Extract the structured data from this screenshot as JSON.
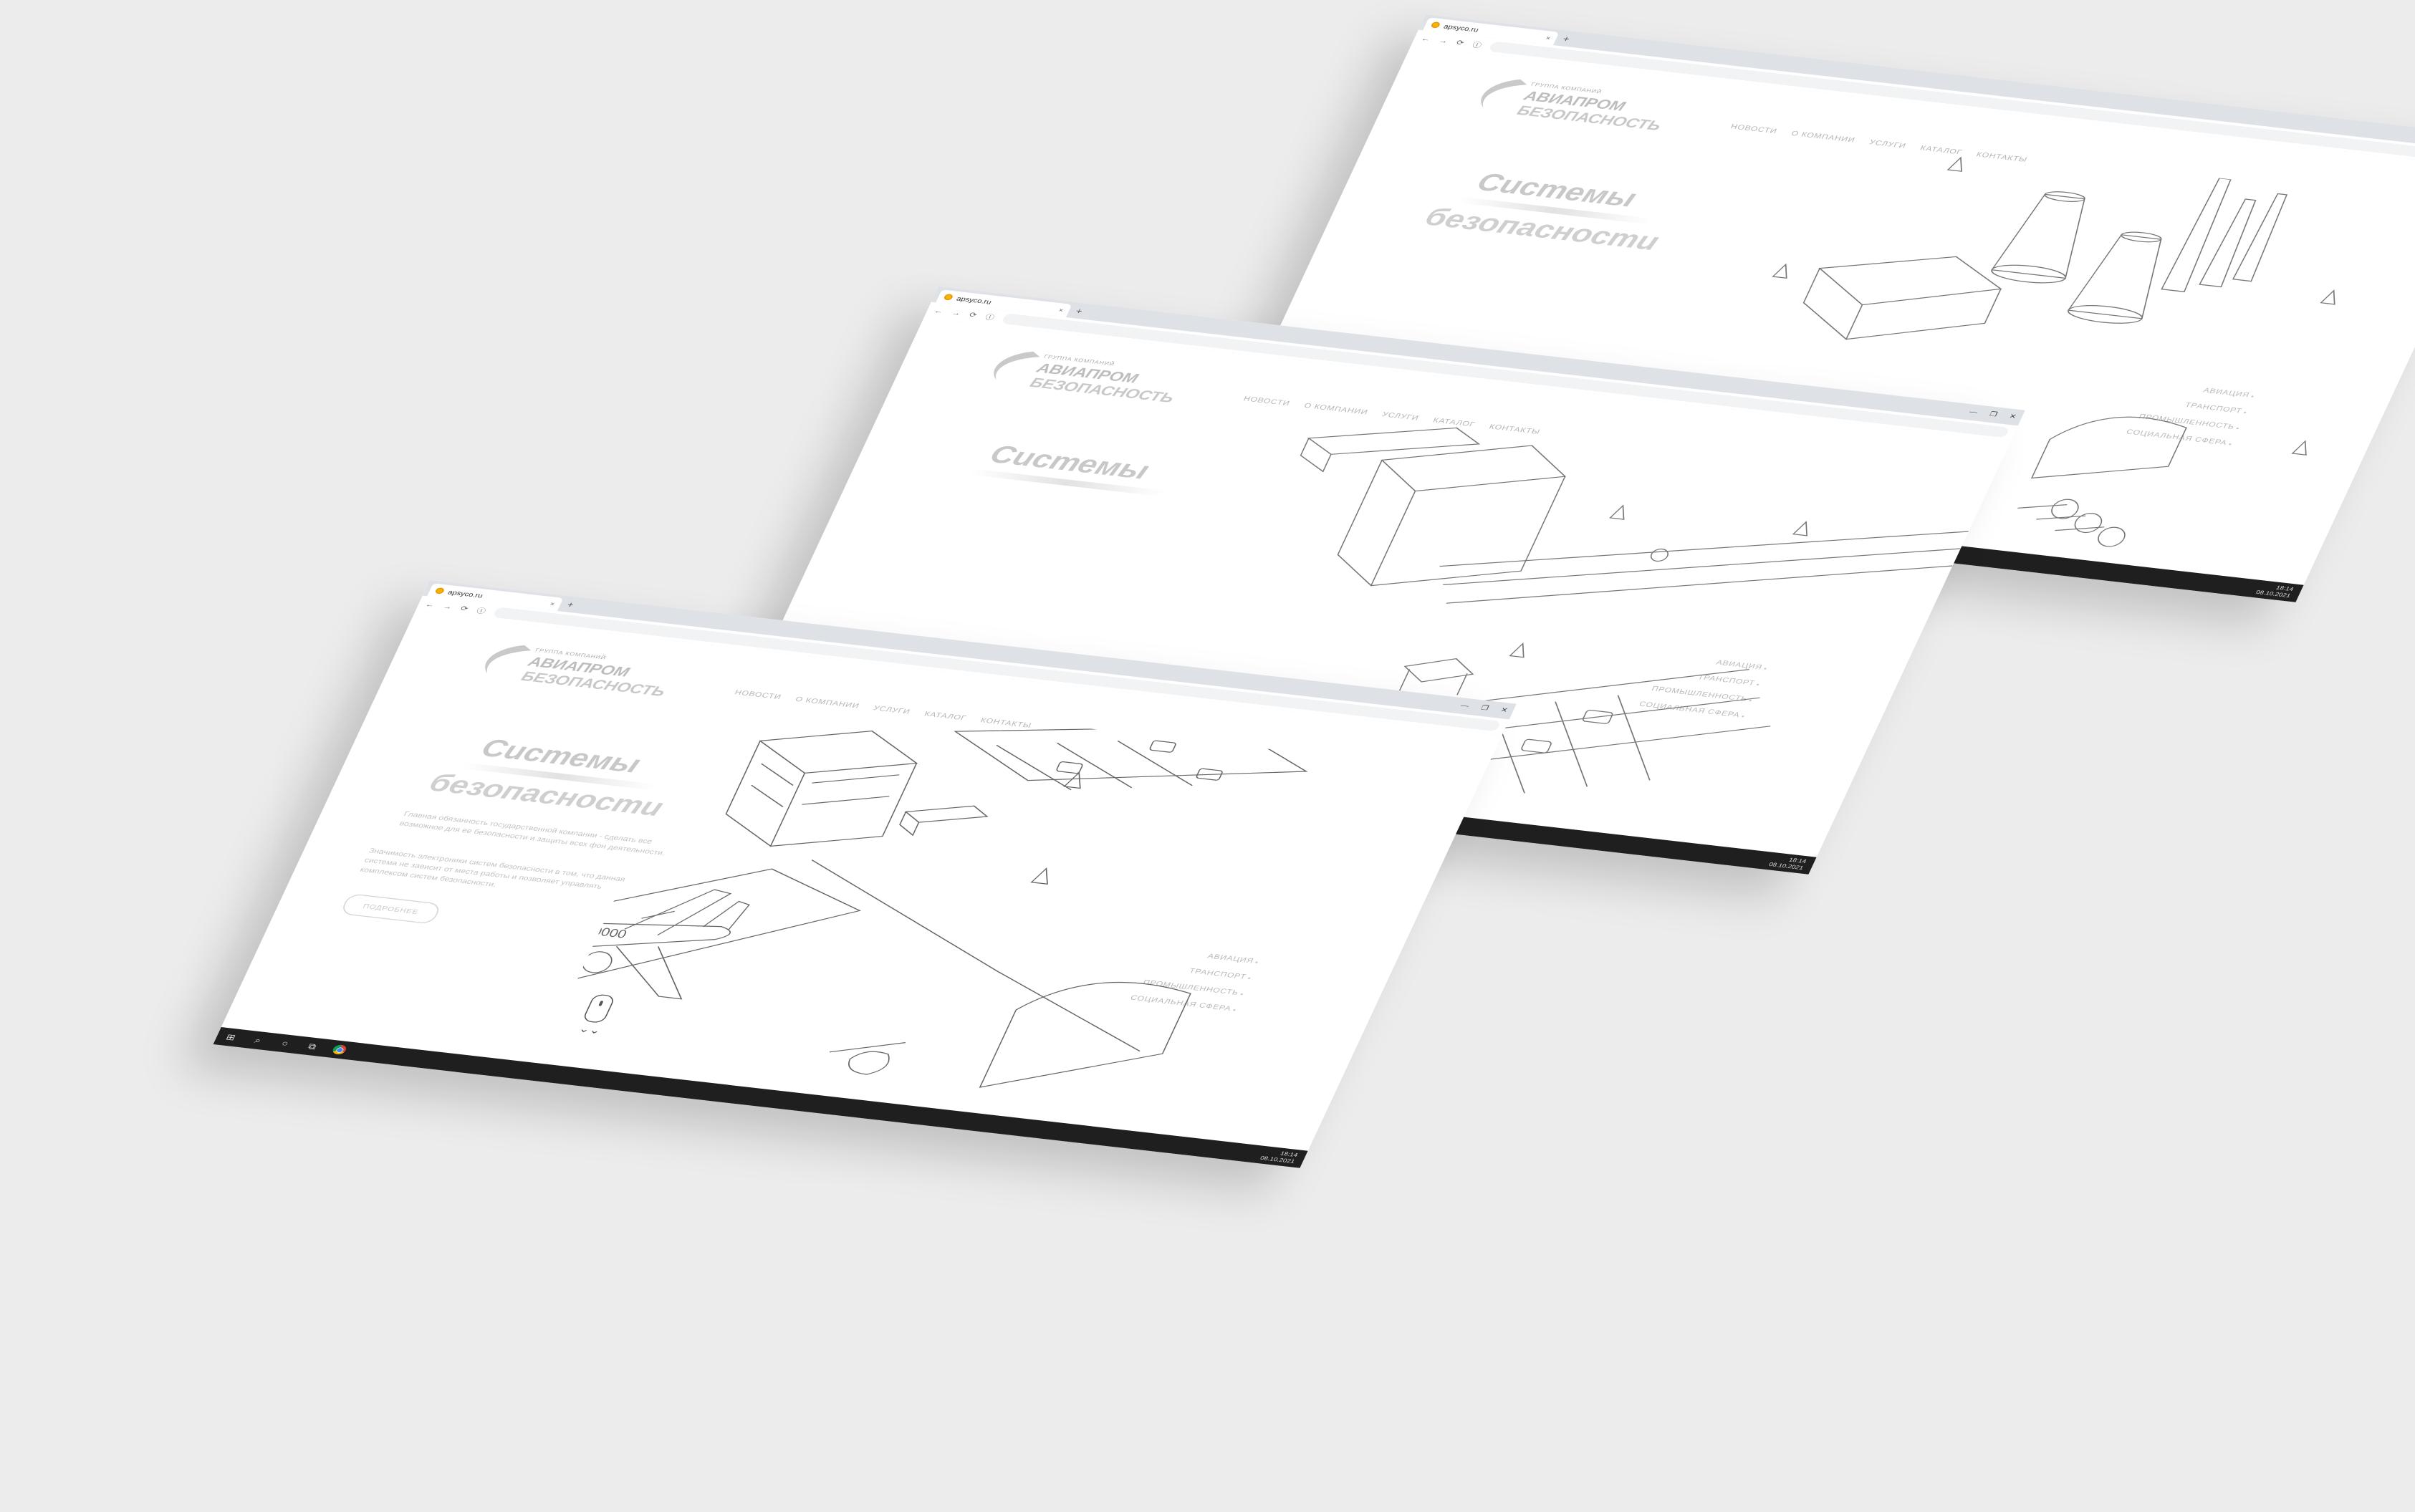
{
  "browser": {
    "tab_title": "аpsyco.ru",
    "tab_close": "×",
    "new_tab": "+",
    "nav_icons": {
      "back": "←",
      "forward": "→",
      "reload": "⟳",
      "info": "ⓘ"
    },
    "window_controls": [
      "—",
      "❐",
      "✕"
    ]
  },
  "site": {
    "logo_small": "ГРУППА КОМПАНИЙ",
    "logo_line1": "АВИАПРОМ",
    "logo_line2": "БЕЗОПАСНОСТЬ",
    "nav": [
      "НОВОСТИ",
      "О КОМПАНИИ",
      "УСЛУГИ",
      "КАТАЛОГ",
      "КОНТАКТЫ"
    ],
    "hero_title_1": "Системы",
    "hero_title_2": "безопасности",
    "hero_p1": "Главная обязанность государственной компании - сделать все возможное для ее безопасности и защиты всех фон деятельности.",
    "hero_p2": "Значимость электроники систем безопасности в том, что данная система не зависит от места работы и позволяет управлять комплексом систем безопасности.",
    "more_button": "ПОДРОБНЕЕ",
    "categories": [
      "АВИАЦИЯ",
      "ТРАНСПОРТ",
      "ПРОМЫШЛЕННОСТЬ",
      "СОЦИАЛЬНАЯ СФЕРА"
    ],
    "scroll_chevron": "⌄⌄",
    "plane_windows": "000000"
  },
  "taskbar": {
    "start_icon": "⊞",
    "search_icon": "⌕",
    "cortana_icon": "○",
    "taskview_icon": "⧉",
    "time": "18:14",
    "date": "08.10.2021"
  }
}
